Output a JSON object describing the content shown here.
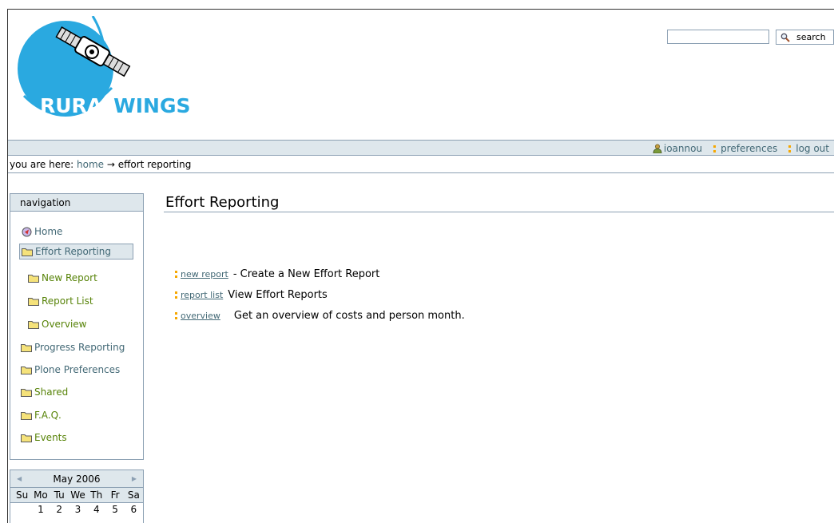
{
  "logo": {
    "part1": "RURAL",
    "part2": "WINGS"
  },
  "search": {
    "placeholder": "",
    "button_label": "search"
  },
  "personal_bar": {
    "user": "ioannou",
    "preferences": "preferences",
    "logout": "log out"
  },
  "breadcrumb": {
    "prefix": "you are here:",
    "home": "home",
    "arrow": "→",
    "current": "effort reporting"
  },
  "navigation": {
    "title": "navigation",
    "items": [
      {
        "label": "Home"
      },
      {
        "label": "Effort Reporting"
      },
      {
        "label": "New Report"
      },
      {
        "label": "Report List"
      },
      {
        "label": "Overview"
      },
      {
        "label": "Progress Reporting"
      },
      {
        "label": "Plone Preferences"
      },
      {
        "label": "Shared"
      },
      {
        "label": "F.A.Q."
      },
      {
        "label": "Events"
      }
    ]
  },
  "calendar": {
    "month": "May 2006",
    "days": [
      "Su",
      "Mo",
      "Tu",
      "We",
      "Th",
      "Fr",
      "Sa"
    ],
    "first_week": [
      "",
      "1",
      "2",
      "3",
      "4",
      "5",
      "6"
    ]
  },
  "content": {
    "title": "Effort Reporting",
    "links": [
      {
        "link": "new report",
        "desc": "- Create a New Effort Report"
      },
      {
        "link": "report list",
        "desc": "View Effort Reports"
      },
      {
        "link": "overview",
        "desc": "Get an overview of costs and person month."
      }
    ]
  },
  "colors": {
    "accent": "#436976",
    "bar": "#dee7ec",
    "border": "#8ca0b3",
    "green": "#578308",
    "logo_blue": "#2aa9e0"
  }
}
